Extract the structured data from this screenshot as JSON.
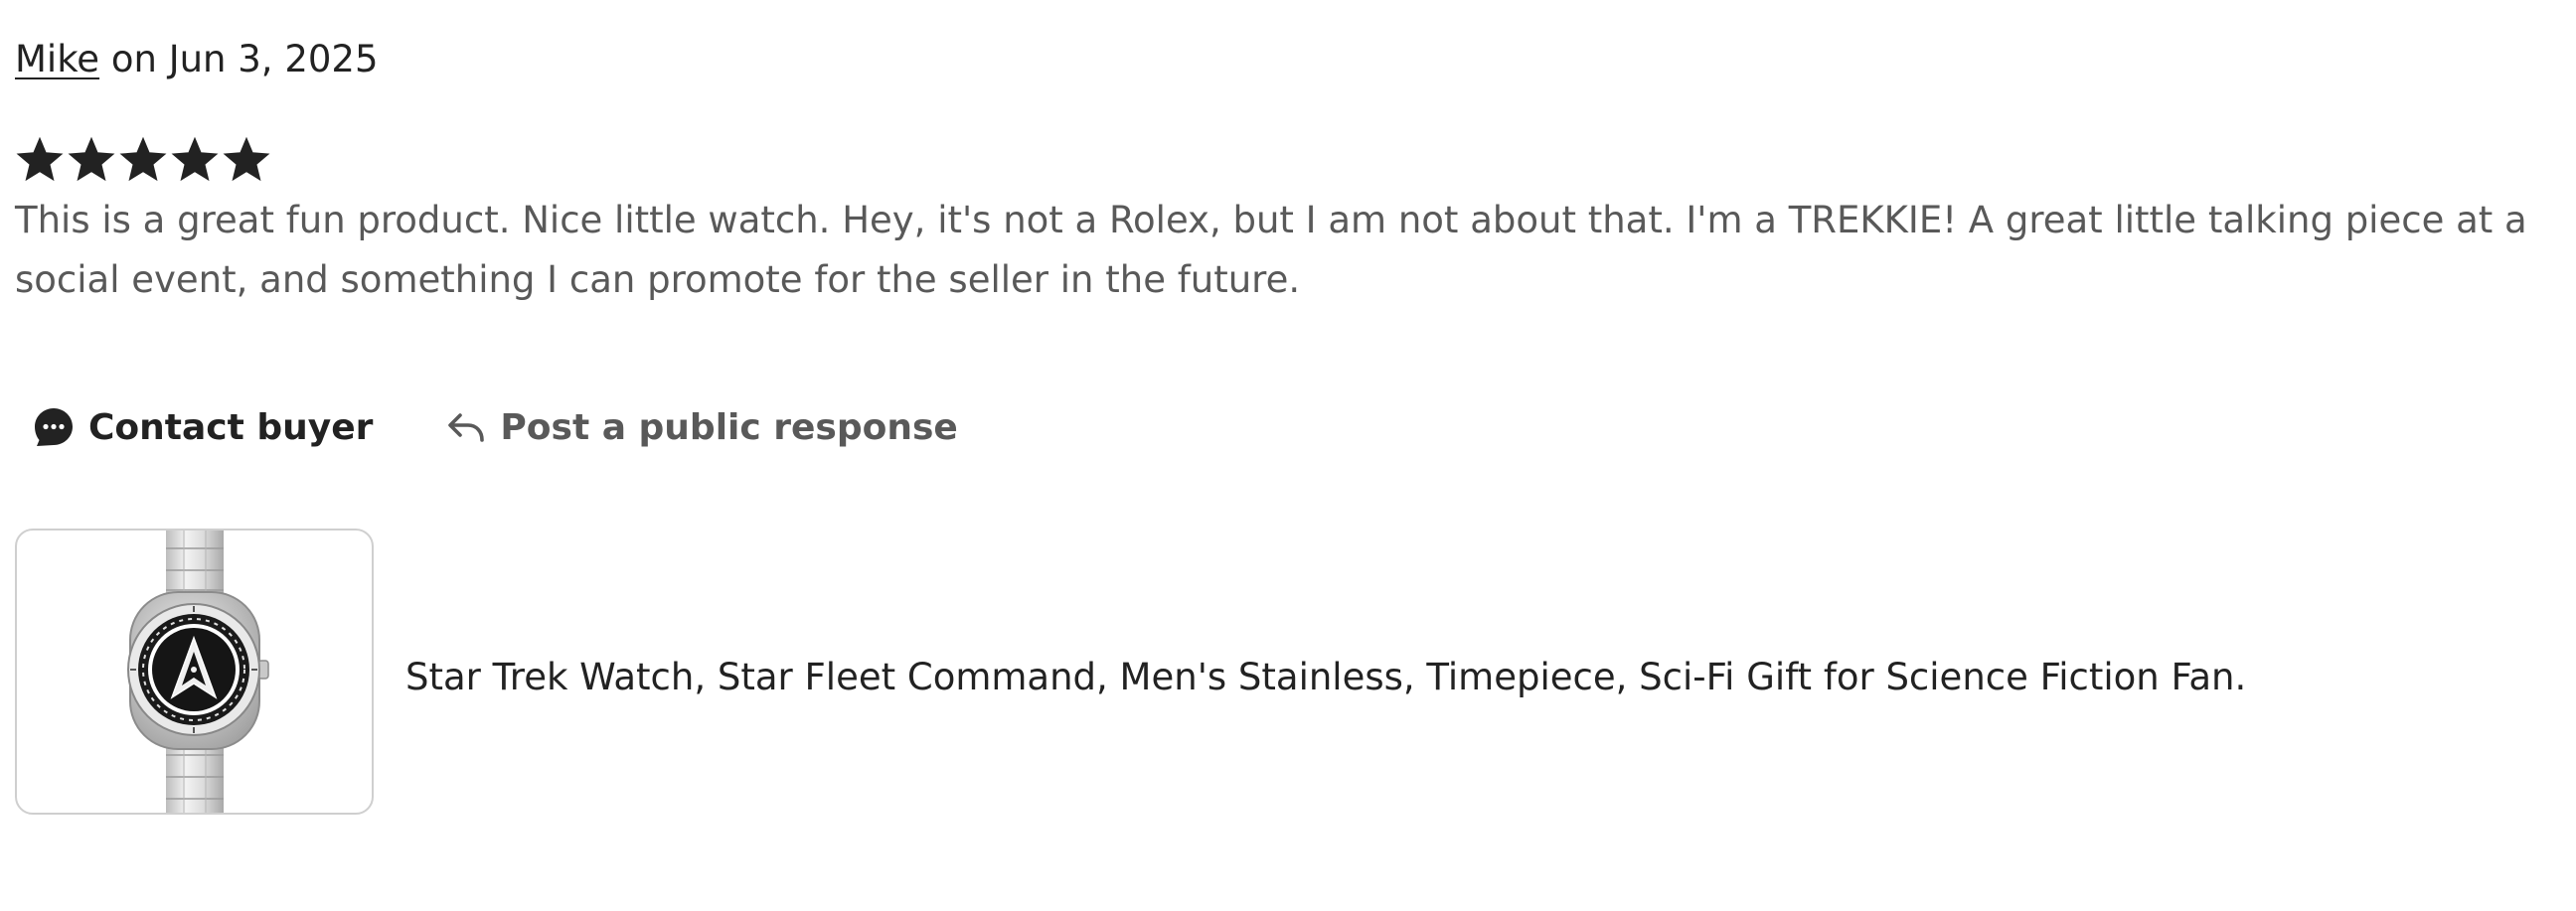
{
  "review": {
    "author": "Mike",
    "date_text": " on Jun 3, 2025",
    "rating": 5,
    "rating_max": 5,
    "text": "This is a great fun product. Nice little watch. Hey, it's not a Rolex, but I am not about that. I'm a TREKKIE! A great little talking piece at a social event, and something I can promote for the seller in the future."
  },
  "actions": {
    "contact_label": "Contact buyer",
    "contact_icon": "chat-bubble-icon",
    "respond_label": "Post a public response",
    "respond_icon": "reply-arrow-icon"
  },
  "product": {
    "title": "Star Trek Watch, Star Fleet Command, Men's Stainless, Timepiece, Sci-Fi Gift for Science Fiction Fan.",
    "image_icon": "watch-product-image"
  },
  "colors": {
    "text_primary": "#222222",
    "text_secondary": "#595959",
    "thumb_border": "#cfcfcf"
  }
}
